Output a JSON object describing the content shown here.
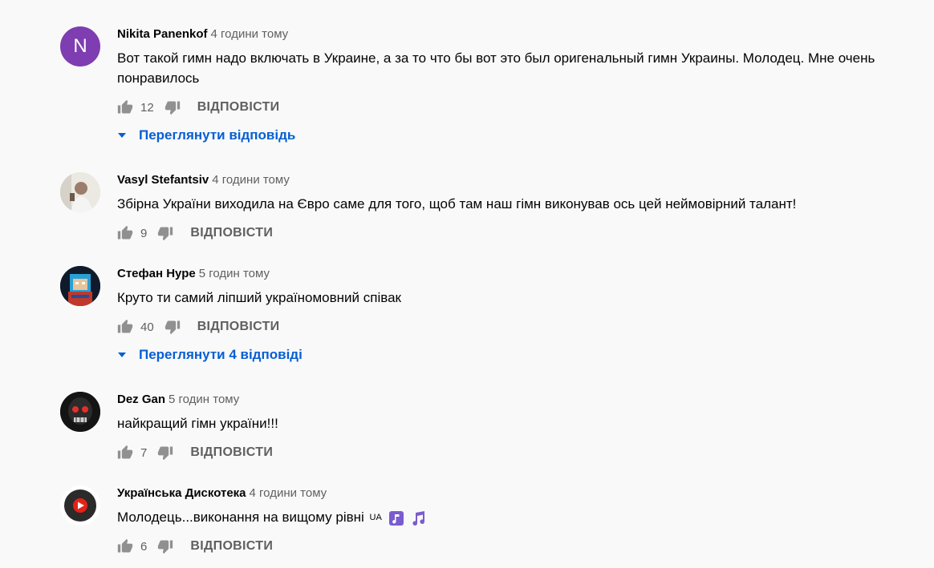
{
  "comments": [
    {
      "author": "Nikita Panenkof",
      "time": "4 години тому",
      "avatar_letter": "N",
      "text": "Вот такой гимн надо включать в Украине, а за то что бы вот это был оригенальный гимн Украины. Молодец. Мне очень понравилось",
      "likes": "12",
      "reply_label": "ВІДПОВІСТИ",
      "view_replies": "Переглянути відповідь"
    },
    {
      "author": "Vasyl Stefantsiv",
      "time": "4 години тому",
      "text": "Збірна України виходила на Євро саме для того, щоб там наш гімн виконував ось цей неймовірний талант!",
      "likes": "9",
      "reply_label": "ВІДПОВІСТИ"
    },
    {
      "author": "Стефан Нуре",
      "time": "5 годин тому",
      "text": "Круто ти самий ліпший україномовний співак",
      "likes": "40",
      "reply_label": "ВІДПОВІСТИ",
      "view_replies": "Переглянути 4 відповіді"
    },
    {
      "author": "Dez Gan",
      "time": "5 годин тому",
      "text": "найкращий гімн україни!!!",
      "likes": "7",
      "reply_label": "ВІДПОВІСТИ"
    },
    {
      "author": "Українська Дискотека",
      "time": "4 години тому",
      "text": "Молодець...виконання на вищому рівні",
      "text_tag": "UA",
      "likes": "6",
      "reply_label": "ВІДПОВІСТИ"
    }
  ],
  "icons": {
    "like": "thumbs-up-icon",
    "dislike": "thumbs-down-icon",
    "caret": "caret-down-icon",
    "music": "music-note-icon"
  },
  "colors": {
    "link_blue": "#065fd4",
    "secondary_text": "#606060",
    "avatar_purple": "#7e3db0",
    "background": "#f9f9f9"
  }
}
